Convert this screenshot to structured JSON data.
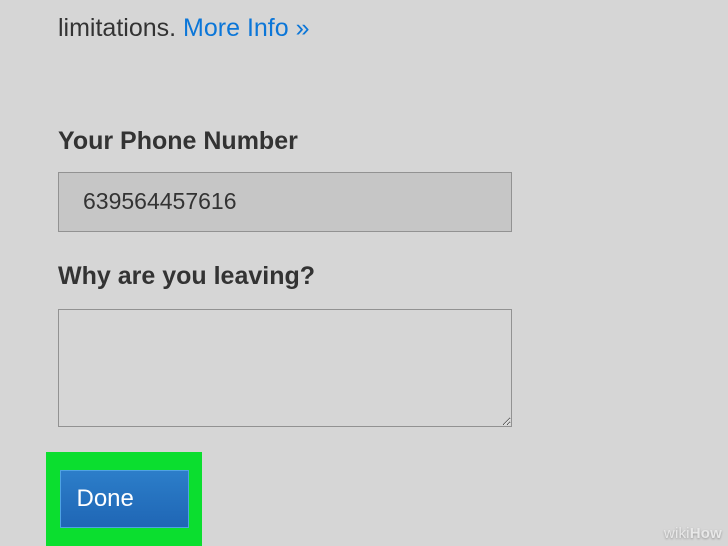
{
  "top": {
    "text_fragment": "limitations.",
    "link_text": "More Info »"
  },
  "phone": {
    "label": "Your Phone Number",
    "value": "639564457616"
  },
  "leaving": {
    "label": "Why are you leaving?",
    "value": ""
  },
  "done": {
    "label": "Done"
  },
  "watermark": {
    "prefix": "wiki",
    "suffix": "How"
  }
}
